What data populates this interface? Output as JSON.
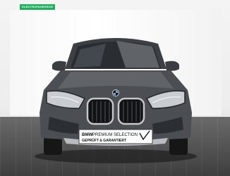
{
  "badge": {
    "label": "ELEKTROFAHRZEUG"
  },
  "plate": {
    "line1_brand": "BMW",
    "line1_rest": " PREMIUM SELECTION",
    "line2": "GEPRÜFT & GARANTIERT"
  },
  "vehicle": {
    "paint_color": "#4b4e53"
  }
}
